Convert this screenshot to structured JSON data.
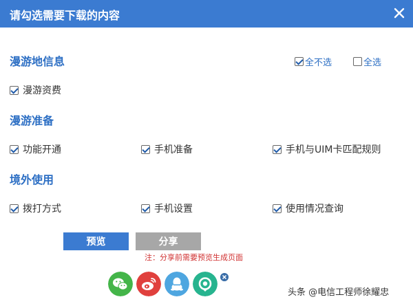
{
  "dialog": {
    "title": "请勾选需要下载的内容"
  },
  "controls": {
    "select_none": "全不选",
    "select_all": "全选"
  },
  "sections": [
    {
      "title": "漫游地信息",
      "items": [
        {
          "label": "漫游资费",
          "checked": true
        }
      ]
    },
    {
      "title": "漫游准备",
      "items": [
        {
          "label": "功能开通",
          "checked": true
        },
        {
          "label": "手机准备",
          "checked": true
        },
        {
          "label": "手机与UIM卡匹配规则",
          "checked": true
        }
      ]
    },
    {
      "title": "境外使用",
      "items": [
        {
          "label": "拨打方式",
          "checked": true
        },
        {
          "label": "手机设置",
          "checked": true
        },
        {
          "label": "使用情况查询",
          "checked": true
        }
      ]
    }
  ],
  "buttons": {
    "preview": "预览",
    "share": "分享"
  },
  "note": "注：分享前需要预览生成页面",
  "share_icons": [
    {
      "name": "wechat-icon",
      "color": "#44b549"
    },
    {
      "name": "weibo-icon",
      "color": "#e0403d"
    },
    {
      "name": "qq-icon",
      "color": "#4ea6e0"
    },
    {
      "name": "qzone-icon",
      "color": "#27b48f"
    }
  ],
  "watermark": "头条 @电信工程师徐耀忠"
}
